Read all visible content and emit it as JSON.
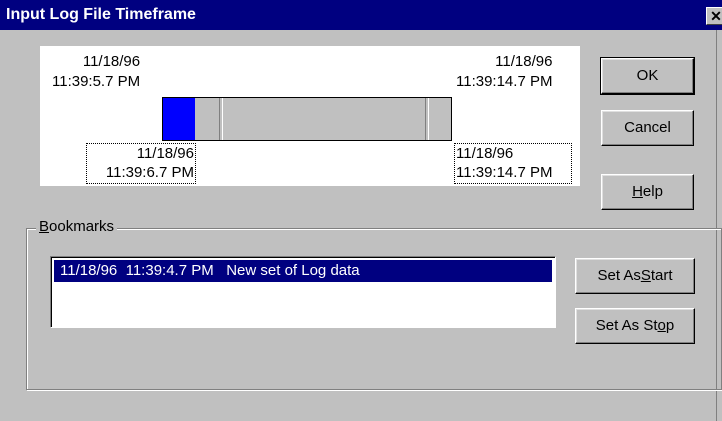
{
  "window": {
    "title": "Input Log File Timeframe",
    "close_glyph": "✕"
  },
  "timeline": {
    "start_date": "11/18/96",
    "start_time": "11:39:5.7 PM",
    "end_date": "11/18/96",
    "end_time": "11:39:14.7 PM",
    "sel_start_date": "11/18/96",
    "sel_start_time": "11:39:6.7 PM",
    "sel_end_date": "11/18/96",
    "sel_end_time": "11:39:14.7 PM",
    "colors": {
      "selection": "#0000ff",
      "track": "#c0c0c0"
    }
  },
  "buttons": {
    "ok": "OK",
    "cancel": "Cancel",
    "help_prefix": "",
    "help_underline": "H",
    "help_suffix": "elp",
    "set_start_prefix": "Set As ",
    "set_start_underline": "S",
    "set_start_suffix": "tart",
    "set_stop_prefix": "Set As St",
    "set_stop_underline": "o",
    "set_stop_suffix": "p"
  },
  "bookmarks": {
    "label_underline": "B",
    "label_rest": "ookmarks",
    "items": [
      {
        "text": "11/18/96  11:39:4.7 PM   New set of Log data",
        "selected": true
      }
    ]
  }
}
